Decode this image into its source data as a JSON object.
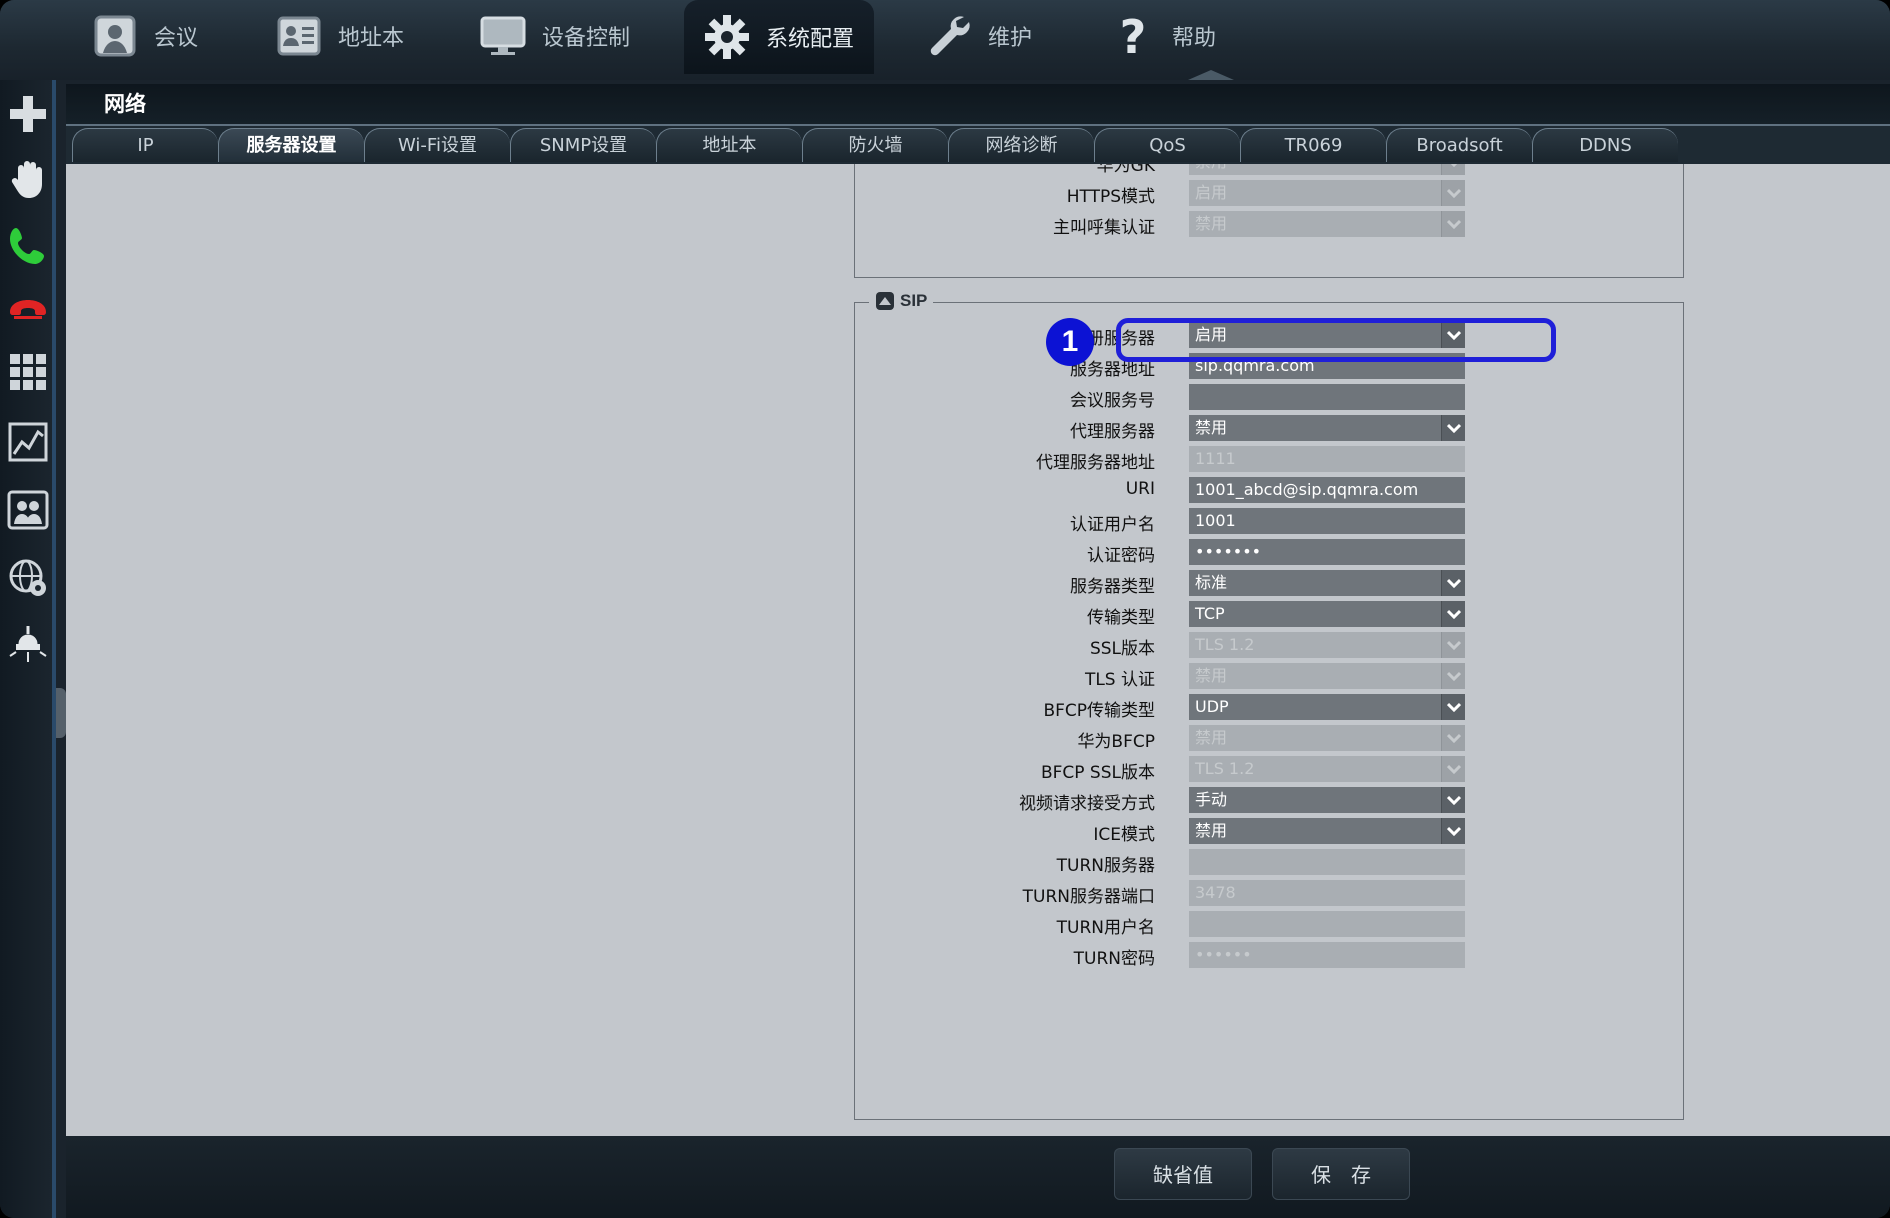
{
  "topnav": {
    "items": [
      {
        "label": "会议",
        "icon": "conference-icon"
      },
      {
        "label": "地址本",
        "icon": "address-book-icon"
      },
      {
        "label": "设备控制",
        "icon": "monitor-icon"
      },
      {
        "label": "系统配置",
        "icon": "gear-icon",
        "active": true
      },
      {
        "label": "维护",
        "icon": "wrench-icon"
      },
      {
        "label": "帮助",
        "icon": "help-icon"
      }
    ]
  },
  "sidebar": {
    "icons": [
      "plus-icon",
      "hand-icon",
      "call-icon",
      "hangup-icon",
      "grid-icon",
      "chart-icon",
      "contacts-icon",
      "globe-settings-icon",
      "lamp-icon"
    ]
  },
  "section": {
    "title": "网络"
  },
  "tabs": [
    {
      "label": "IP"
    },
    {
      "label": "服务器设置",
      "active": true
    },
    {
      "label": "Wi-Fi设置"
    },
    {
      "label": "SNMP设置"
    },
    {
      "label": "地址本"
    },
    {
      "label": "防火墙"
    },
    {
      "label": "网络诊断"
    },
    {
      "label": "QoS"
    },
    {
      "label": "TR069"
    },
    {
      "label": "Broadsoft"
    },
    {
      "label": "DDNS"
    }
  ],
  "upper_group": {
    "rows": [
      {
        "label": "华为GK",
        "value": "禁用",
        "type": "select",
        "disabled": true
      },
      {
        "label": "HTTPS模式",
        "value": "启用",
        "type": "select",
        "disabled": true
      },
      {
        "label": "主叫呼集认证",
        "value": "禁用",
        "type": "select",
        "disabled": true
      }
    ]
  },
  "sip": {
    "legend": "SIP",
    "rows": [
      {
        "label": "注册服务器",
        "value": "启用",
        "type": "select",
        "disabled": false
      },
      {
        "label": "服务器地址",
        "value": "sip.qqmra.com",
        "type": "input",
        "disabled": false
      },
      {
        "label": "会议服务号",
        "value": "",
        "type": "input",
        "disabled": false
      },
      {
        "label": "代理服务器",
        "value": "禁用",
        "type": "select",
        "disabled": false
      },
      {
        "label": "代理服务器地址",
        "value": "1111",
        "type": "input",
        "disabled": true
      },
      {
        "label": "URI",
        "value": "1001_abcd@sip.qqmra.com",
        "type": "input",
        "disabled": false
      },
      {
        "label": "认证用户名",
        "value": "1001",
        "type": "input",
        "disabled": false
      },
      {
        "label": "认证密码",
        "value": "•••••••",
        "type": "input",
        "disabled": false
      },
      {
        "label": "服务器类型",
        "value": "标准",
        "type": "select",
        "disabled": false
      },
      {
        "label": "传输类型",
        "value": "TCP",
        "type": "select",
        "disabled": false
      },
      {
        "label": "SSL版本",
        "value": "TLS 1.2",
        "type": "select",
        "disabled": true
      },
      {
        "label": "TLS 认证",
        "value": "禁用",
        "type": "select",
        "disabled": true
      },
      {
        "label": "BFCP传输类型",
        "value": "UDP",
        "type": "select",
        "disabled": false
      },
      {
        "label": "华为BFCP",
        "value": "禁用",
        "type": "select",
        "disabled": true
      },
      {
        "label": "BFCP SSL版本",
        "value": "TLS 1.2",
        "type": "select",
        "disabled": true
      },
      {
        "label": "视频请求接受方式",
        "value": "手动",
        "type": "select",
        "disabled": false
      },
      {
        "label": "ICE模式",
        "value": "禁用",
        "type": "select",
        "disabled": false
      },
      {
        "label": "TURN服务器",
        "value": "",
        "type": "input",
        "disabled": true
      },
      {
        "label": "TURN服务器端口",
        "value": "3478",
        "type": "input",
        "disabled": true
      },
      {
        "label": "TURN用户名",
        "value": "",
        "type": "input",
        "disabled": true
      },
      {
        "label": "TURN密码",
        "value": "••••••",
        "type": "input",
        "disabled": true
      }
    ]
  },
  "annotation": {
    "badge": "1",
    "color": "#1f1fd8"
  },
  "footer": {
    "default_label": "缺省值",
    "save_label": "保　存"
  }
}
